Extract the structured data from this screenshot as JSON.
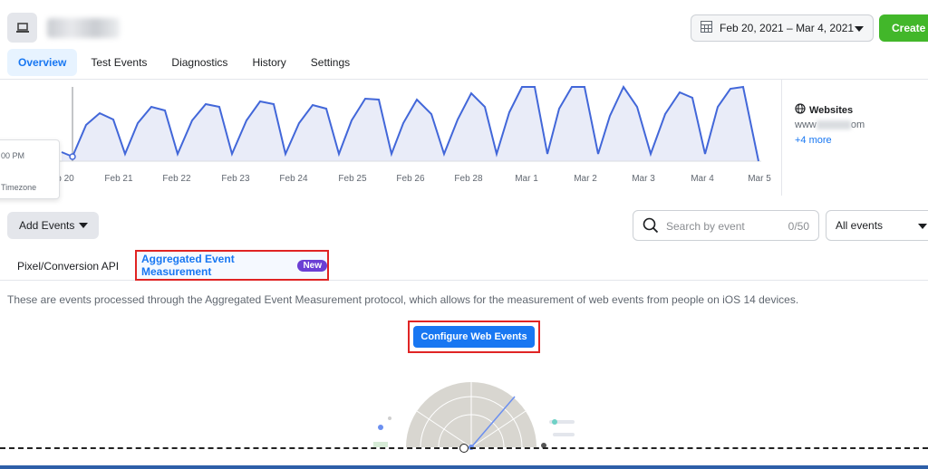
{
  "header": {
    "date_range": "Feb 20, 2021 – Mar 4, 2021",
    "create_label": "Create"
  },
  "tabs": [
    {
      "label": "Overview",
      "active": true
    },
    {
      "label": "Test Events",
      "active": false
    },
    {
      "label": "Diagnostics",
      "active": false
    },
    {
      "label": "History",
      "active": false
    },
    {
      "label": "Settings",
      "active": false
    }
  ],
  "chart": {
    "tooltip_time": "00 PM",
    "tooltip_timezone": "Timezone",
    "x_labels": [
      "b 20",
      "Feb 21",
      "Feb 22",
      "Feb 23",
      "Feb 24",
      "Feb 25",
      "Feb 26",
      "Feb 28",
      "Mar 1",
      "Mar 2",
      "Mar 3",
      "Mar 4",
      "Mar 5"
    ],
    "line_color": "#4267d9",
    "fill_color": "#e9ecf8"
  },
  "websites": {
    "title": "Websites",
    "site_prefix": "www",
    "site_suffix": "om",
    "more": "+4 more"
  },
  "toolbar": {
    "add_events_label": "Add Events",
    "search_placeholder": "Search by event",
    "search_counter": "0/50",
    "filter_value": "All events"
  },
  "subtabs": {
    "pixel_label": "Pixel/Conversion API",
    "aem_label": "Aggregated Event Measurement",
    "new_badge": "New"
  },
  "description": "These are events processed through the Aggregated Event Measurement protocol, which allows for the measurement of web events from people on iOS 14 devices.",
  "configure_label": "Configure Web Events",
  "colors": {
    "primary": "#1877f2",
    "create_green": "#42b72a",
    "highlight_red": "#e02424",
    "badge_purple": "#6b3fd4"
  }
}
